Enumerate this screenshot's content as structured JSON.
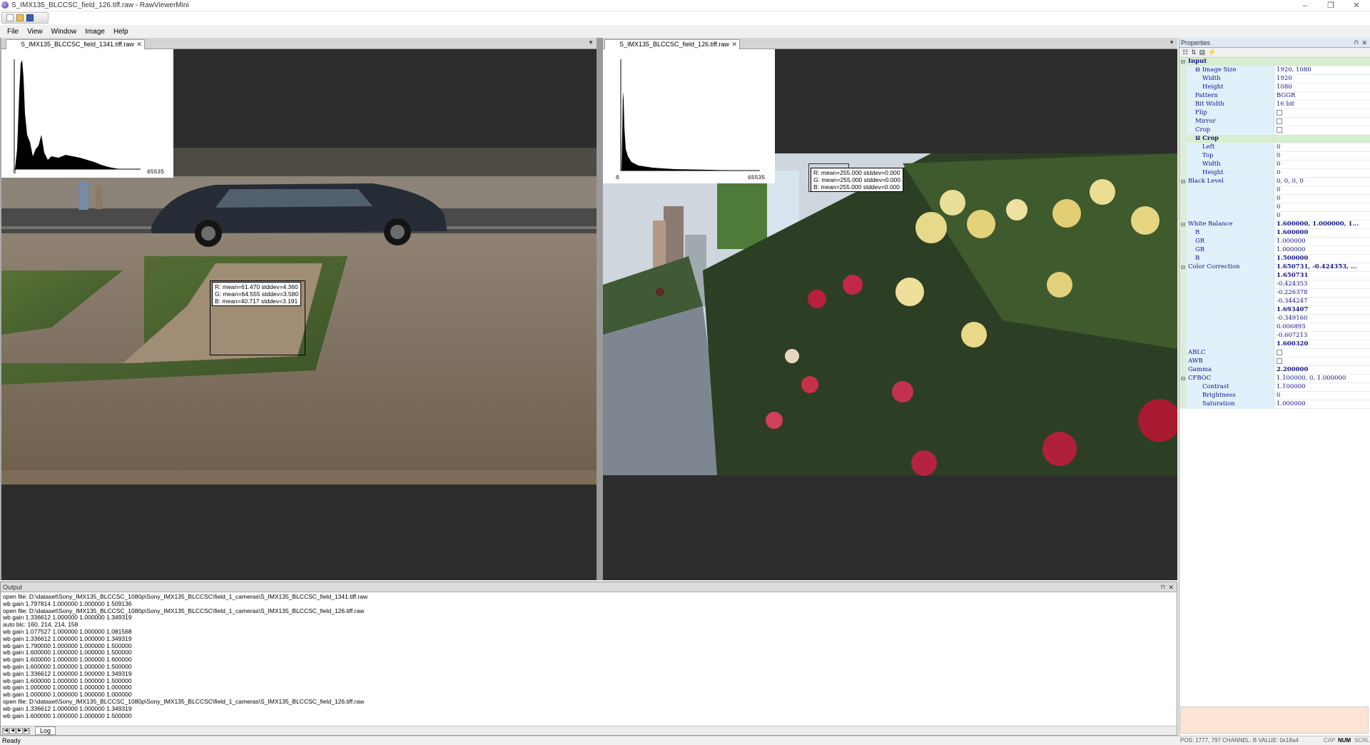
{
  "window": {
    "title": "S_IMX135_BLCCSC_field_126.tiff.raw - RawViewerMini",
    "minimize": "–",
    "maximize": "❐",
    "close": "✕"
  },
  "menu": [
    "File",
    "View",
    "Window",
    "Image",
    "Help"
  ],
  "views": {
    "left": {
      "tab": "S_IMX135_BLCCSC_field_1341.tiff.raw",
      "hist_min": "0",
      "hist_max": "65535",
      "stats": [
        "R: mean=61.470 stddev=4.360",
        "G: mean=64.555 stddev=3.580",
        "B: mean=40.717 stddev=3.191"
      ]
    },
    "right": {
      "tab": "S_IMX135_BLCCSC_field_126.tiff.raw",
      "hist_min": "0",
      "hist_max": "65535",
      "stats": [
        "R: mean=255.000 stddev=0.000",
        "G: mean=255.000 stddev=0.000",
        "B: mean=255.000 stddev=0.000"
      ]
    }
  },
  "properties": {
    "title": "Properties",
    "rows": [
      {
        "name": "Input",
        "value": "",
        "cat": true,
        "exp": "⊟"
      },
      {
        "name": "Image Size",
        "value": "1920, 1080",
        "indent": 1,
        "exp": "⊟"
      },
      {
        "name": "Width",
        "value": "1920",
        "indent": 2
      },
      {
        "name": "Height",
        "value": "1080",
        "indent": 2
      },
      {
        "name": "Pattern",
        "value": "BGGR",
        "indent": 1
      },
      {
        "name": "Bit Width",
        "value": "16 bit",
        "indent": 1
      },
      {
        "name": "Flip",
        "value": "",
        "indent": 1,
        "check": true
      },
      {
        "name": "Mirror",
        "value": "",
        "indent": 1,
        "check": true
      },
      {
        "name": "Crop",
        "value": "",
        "indent": 1,
        "check": true
      },
      {
        "name": "Crop",
        "value": "",
        "cat": true,
        "indent": 1,
        "exp": "⊟"
      },
      {
        "name": "Left",
        "value": "0",
        "indent": 2
      },
      {
        "name": "Top",
        "value": "0",
        "indent": 2
      },
      {
        "name": "Width",
        "value": "0",
        "indent": 2
      },
      {
        "name": "Height",
        "value": "0",
        "indent": 2
      },
      {
        "name": "Black Level",
        "value": "0, 0, 0, 0",
        "exp": "⊟"
      },
      {
        "name": "",
        "value": "0",
        "indent": 1
      },
      {
        "name": "",
        "value": "0",
        "indent": 1
      },
      {
        "name": "",
        "value": "0",
        "indent": 1
      },
      {
        "name": "",
        "value": "0",
        "indent": 1
      },
      {
        "name": "White Balance",
        "value": "1.600000, 1.000000, 1...",
        "bold": true,
        "exp": "⊟"
      },
      {
        "name": "R",
        "value": "1.600000",
        "indent": 1,
        "bold": true
      },
      {
        "name": "GR",
        "value": "1.000000",
        "indent": 1
      },
      {
        "name": "GB",
        "value": "1.000000",
        "indent": 1
      },
      {
        "name": "B",
        "value": "1.500000",
        "indent": 1,
        "bold": true
      },
      {
        "name": "Color Correction",
        "value": "1.650731, -0.424353, ...",
        "bold": true,
        "exp": "⊟"
      },
      {
        "name": "",
        "value": "1.650731",
        "indent": 1,
        "bold": true
      },
      {
        "name": "",
        "value": "-0.424353",
        "indent": 1
      },
      {
        "name": "",
        "value": "-0.226378",
        "indent": 1
      },
      {
        "name": "",
        "value": "-0.344247",
        "indent": 1
      },
      {
        "name": "",
        "value": "1.693407",
        "indent": 1,
        "bold": true
      },
      {
        "name": "",
        "value": "-0.349160",
        "indent": 1
      },
      {
        "name": "",
        "value": "0.006893",
        "indent": 1
      },
      {
        "name": "",
        "value": "-0.607213",
        "indent": 1
      },
      {
        "name": "",
        "value": "1.600320",
        "indent": 1,
        "bold": true
      },
      {
        "name": "ABLC",
        "value": "",
        "check": true,
        "noexp": true
      },
      {
        "name": "AWB",
        "value": "",
        "check": true,
        "noexp": true
      },
      {
        "name": "Gamma",
        "value": "2.200000",
        "bold": true,
        "noexp": true
      },
      {
        "name": "CFBOC",
        "value": "1.100000, 0, 1.000000",
        "exp": "⊟",
        "noexp": true
      },
      {
        "name": "Contrast",
        "value": "1.100000",
        "indent": 2
      },
      {
        "name": "Brightness",
        "value": "0",
        "indent": 2
      },
      {
        "name": "Saturation",
        "value": "1.000000",
        "indent": 2
      }
    ]
  },
  "output": {
    "title": "Output",
    "tab": "Log",
    "lines": [
      "open file: D:\\dataset\\Sony_IMX135_BLCCSC_1080p\\Sony_IMX135_BLCCSC\\field_1_cameras\\S_IMX135_BLCCSC_field_1341.tiff.raw",
      "wb gain 1.797814 1.000000 1.000000 1.509136",
      "open file: D:\\dataset\\Sony_IMX135_BLCCSC_1080p\\Sony_IMX135_BLCCSC\\field_1_cameras\\S_IMX135_BLCCSC_field_126.tiff.raw",
      "wb gain 1.336612 1.000000 1.000000 1.349319",
      "auto blc: 160, 214, 214, 158",
      "wb gain 1.077527 1.000000 1.000000 1.081568",
      "wb gain 1.336612 1.000000 1.000000 1.349319",
      "wb gain 1.790000 1.000000 1.000000 1.500000",
      "wb gain 1.600000 1.000000 1.000000 1.500000",
      "wb gain 1.600000 1.000000 1.000000 1.600000",
      "wb gain 1.600000 1.000000 1.000000 1.500000",
      "wb gain 1.336612 1.000000 1.000000 1.349319",
      "wb gain 1.600000 1.000000 1.000000 1.500000",
      "wb gain 1.000000 1.000000 1.000000 1.000000",
      "wb gain 1.000000 1.000000 1.000000 1.000000",
      "open file: D:\\dataset\\Sony_IMX135_BLCCSC_1080p\\Sony_IMX135_BLCCSC\\field_1_cameras\\S_IMX135_BLCCSC_field_126.tiff.raw",
      "wb gain 1.336612 1.000000 1.000000 1.349319",
      "wb gain 1.600000 1.000000 1.000000 1.500000"
    ]
  },
  "status": {
    "ready": "Ready",
    "info": "POS: 1777, 797   CHANNEL: B  VALUE: 0x18a4",
    "cap": "CAP",
    "num": "NUM",
    "scrl": "SCRL"
  }
}
